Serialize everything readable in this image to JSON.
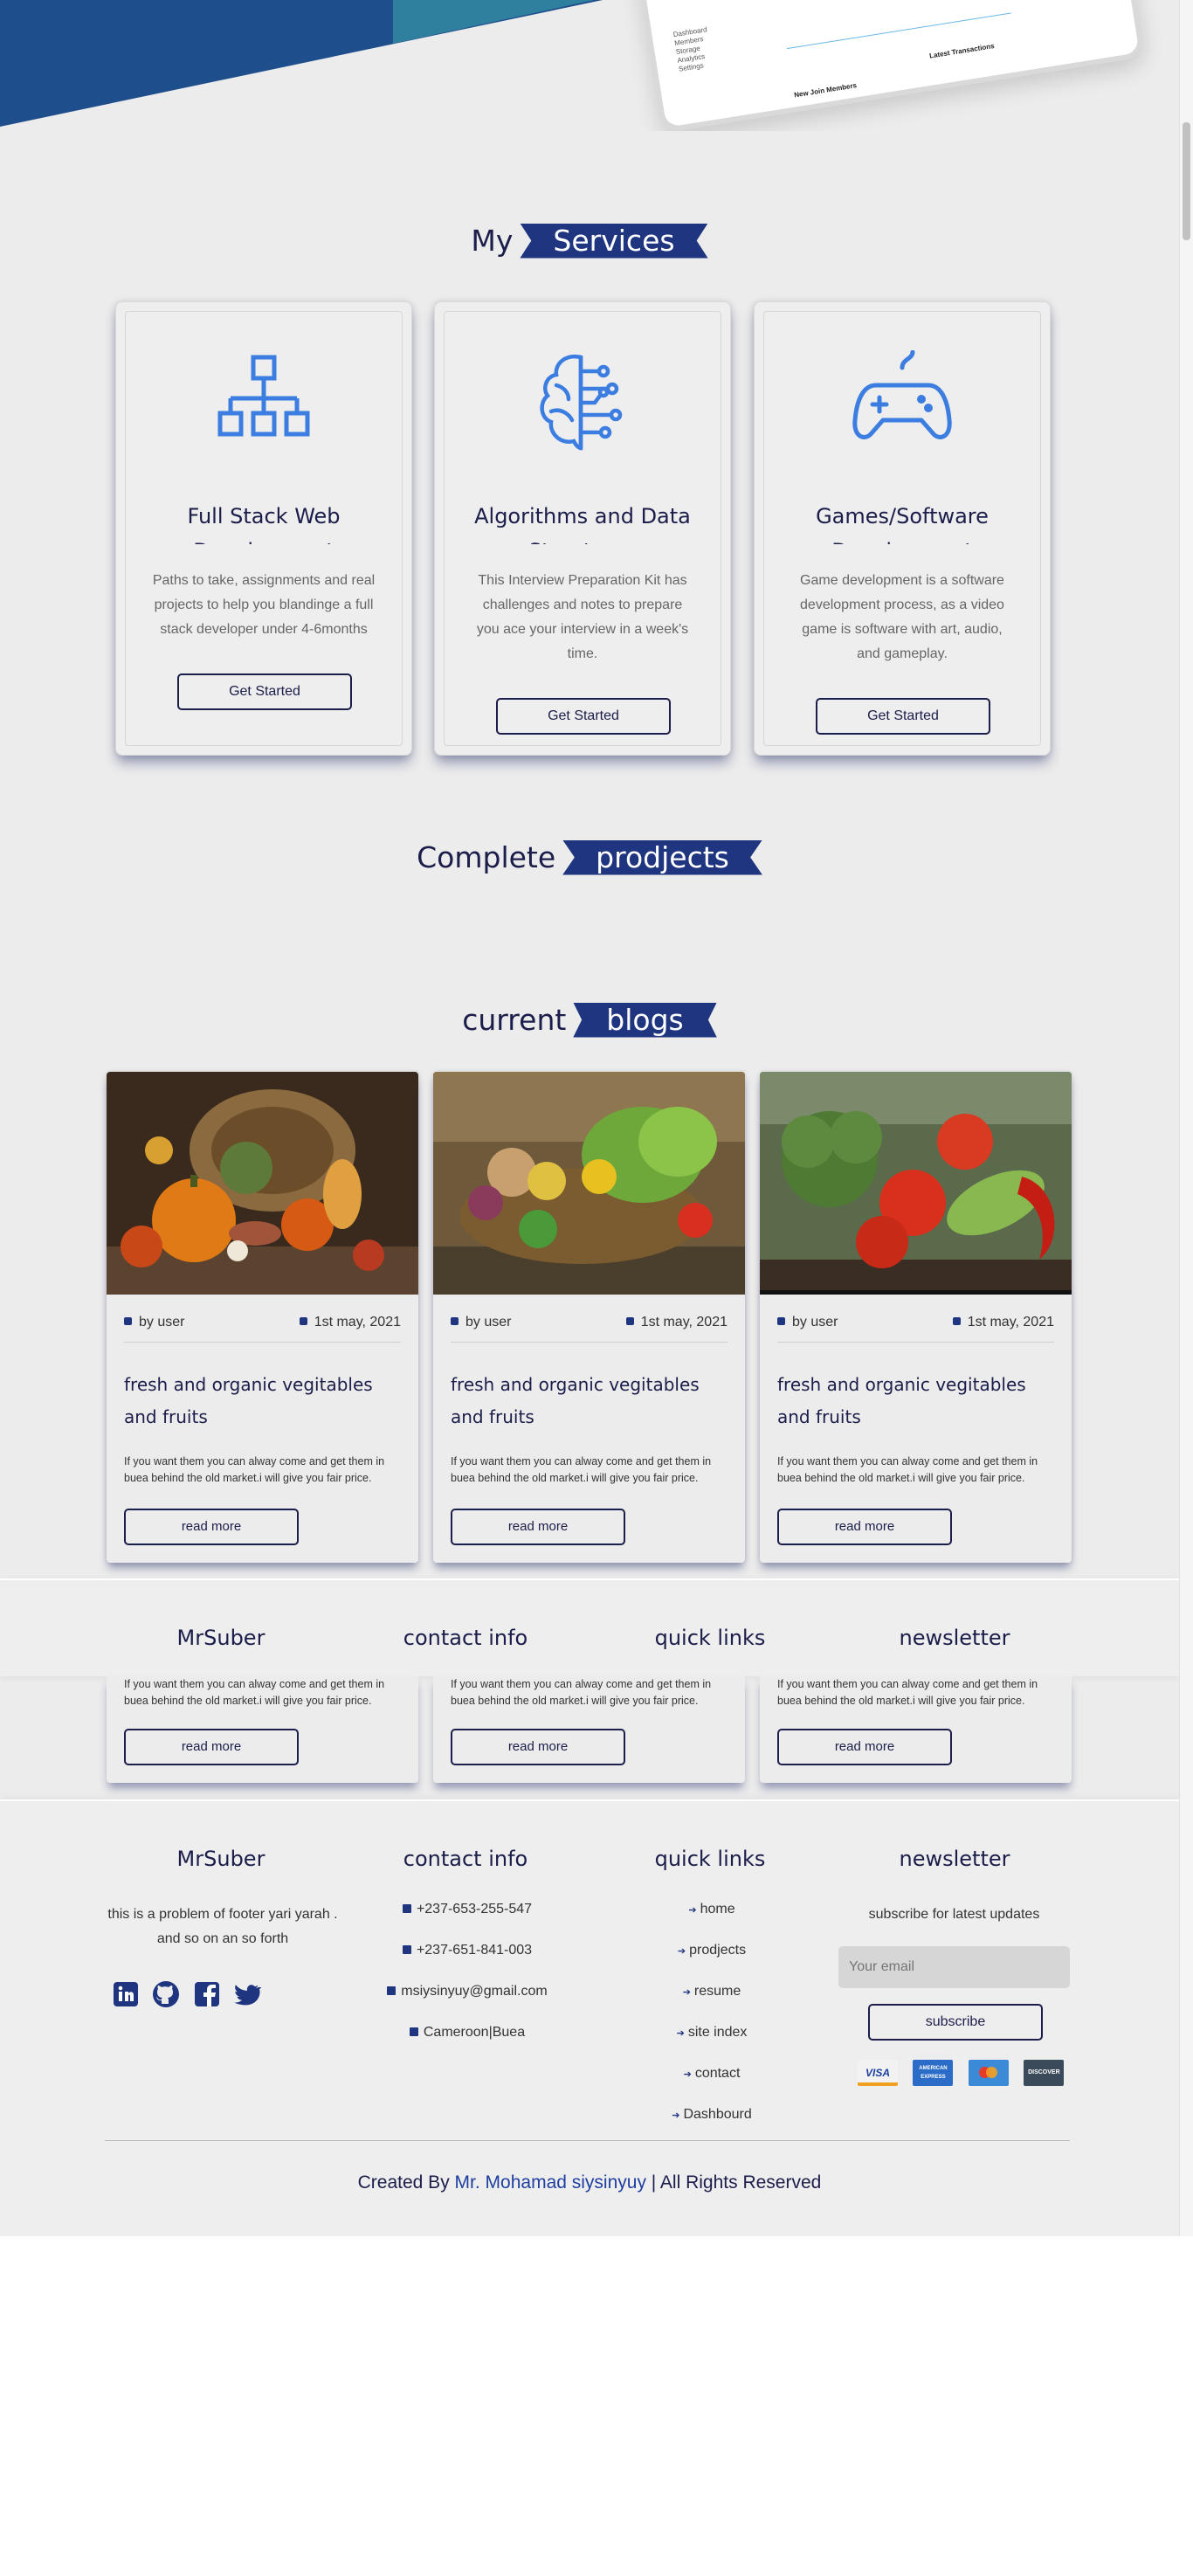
{
  "hero": {
    "device": {
      "sidebar": [
        "Dashboard",
        "Members",
        "Storage",
        "Analytics",
        "Settings"
      ],
      "new_members": "New Join Members",
      "transactions": "Latest Transactions"
    }
  },
  "services": {
    "title_plain": "My",
    "title_ribbon": "Services",
    "items": [
      {
        "icon": "sitemap-icon",
        "title": "Full Stack Web Development",
        "desc": "Paths to take, assignments and real projects to help you blandinge a full stack developer under 4-6months",
        "button": "Get Started"
      },
      {
        "icon": "brain-circuit-icon",
        "title": "Algorithms and Data Structures",
        "desc": "This Interview Preparation Kit has challenges and notes to prepare you ace your interview in a week's time.",
        "button": "Get Started"
      },
      {
        "icon": "gamepad-icon",
        "title": "Games/Software Development",
        "desc": "Game development is a software development process, as a video game is software with art, audio, and gameplay.",
        "button": "Get Started"
      }
    ]
  },
  "projects": {
    "title_plain": "Complete",
    "title_ribbon": "prodjects"
  },
  "blogs": {
    "title_plain": "current",
    "title_ribbon": "blogs",
    "items": [
      {
        "author": "by user",
        "date": "1st may, 2021",
        "title": "fresh and organic vegitables and fruits",
        "desc": "If you want them you can alway come and get them in buea behind the old market.i will give you fair price.",
        "button": "read more"
      },
      {
        "author": "by user",
        "date": "1st may, 2021",
        "title": "fresh and organic vegitables and fruits",
        "desc": "If you want them you can alway come and get them in buea behind the old market.i will give you fair price.",
        "button": "read more"
      },
      {
        "author": "by user",
        "date": "1st may, 2021",
        "title": "fresh and organic vegitables and fruits",
        "desc": "If you want them you can alway come and get them in buea behind the old market.i will give you fair price.",
        "button": "read more"
      }
    ]
  },
  "footer": {
    "brand": "MrSuber",
    "about": "this is a problem of footer yari yarah . and so on an so forth",
    "contact_title": "contact info",
    "contacts": [
      "+237-653-255-547",
      "+237-651-841-003",
      "msiysinyuy@gmail.com",
      "Cameroon|Buea"
    ],
    "links_title": "quick links",
    "links": [
      "home",
      "prodjects",
      "resume",
      "site index",
      "contact",
      "Dashbourd"
    ],
    "newsletter_title": "newsletter",
    "newsletter_text": "subscribe for latest updates",
    "email_placeholder": "Your email",
    "subscribe": "subscribe",
    "cards": [
      "VISA",
      "AMERICAN EXPRESS",
      "",
      "DISCOVER"
    ],
    "credit_prefix": "Created By",
    "credit_name": "Mr. Mohamad siysinyuy",
    "credit_suffix": "| All Rights Reserved"
  },
  "colors": {
    "accent": "#1f3580",
    "background": "#ececec",
    "icon": "#3b7de0"
  }
}
